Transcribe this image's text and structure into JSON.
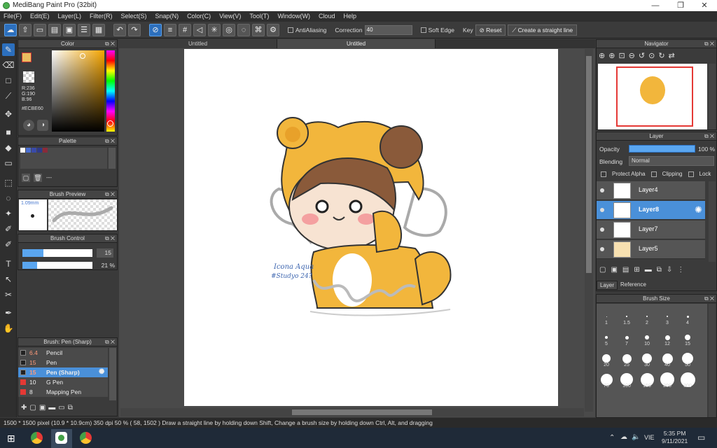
{
  "window": {
    "title": "MediBang Paint Pro (32bit)",
    "min": "—",
    "max": "❐",
    "close": "✕"
  },
  "menu": [
    "File(F)",
    "Edit(E)",
    "Layer(L)",
    "Filter(R)",
    "Select(S)",
    "Snap(N)",
    "Color(C)",
    "View(V)",
    "Tool(T)",
    "Window(W)",
    "Cloud",
    "Help"
  ],
  "toolbar": {
    "antialiasing": "AntiAliasing",
    "correction_label": "Correction",
    "correction_value": "40",
    "soft_edge": "Soft Edge",
    "key_label": "Key",
    "reset": "Reset",
    "straight_line": "Create a straight line"
  },
  "tabs": [
    "Untitled",
    "Untitled"
  ],
  "color_panel": {
    "title": "Color",
    "r": "R:236",
    "g": "G:190",
    "b": "B:96",
    "hex": "#ECBE60",
    "fg": "#ecbe60"
  },
  "palette_panel": {
    "title": "Palette",
    "placeholder": "---"
  },
  "brush_preview": {
    "title": "Brush Preview",
    "size": "1.09mm"
  },
  "brush_control": {
    "title": "Brush Control",
    "size_value": "15",
    "opacity_value": "21 %"
  },
  "brush_list": {
    "title": "Brush: Pen (Sharp)",
    "items": [
      {
        "size": "6.4",
        "name": "Pencil",
        "color": "#222"
      },
      {
        "size": "15",
        "name": "Pen",
        "color": "#222"
      },
      {
        "size": "15",
        "name": "Pen (Sharp)",
        "color": "#222"
      },
      {
        "size": "10",
        "name": "G Pen",
        "color": "#e53935"
      },
      {
        "size": "8",
        "name": "Mapping Pen",
        "color": "#e53935"
      }
    ]
  },
  "navigator": {
    "title": "Navigator"
  },
  "layer_panel": {
    "title": "Layer",
    "opacity_label": "Opacity",
    "opacity_value": "100 %",
    "opacity_level": 1.0,
    "blending_label": "Blending",
    "blending_value": "Normal",
    "protect_alpha": "Protect Alpha",
    "clipping": "Clipping",
    "lock": "Lock",
    "layers": [
      "Layer4",
      "Layer8",
      "Layer7",
      "Layer5"
    ],
    "tabs": [
      "Layer",
      "Reference"
    ]
  },
  "brush_size": {
    "title": "Brush Size",
    "sizes": [
      "1",
      "1.5",
      "2",
      "3",
      "4",
      "5",
      "7",
      "10",
      "12",
      "15",
      "20",
      "25",
      "30",
      "40",
      "50",
      "70",
      "100",
      "150",
      "200",
      "300"
    ]
  },
  "canvas": {
    "signature_line1": "Icona Aqua",
    "signature_line2": "#Studyo 24?"
  },
  "status": "1500 * 1500 pixel   (10.9 * 10.9cm)  350 dpi   50 %   ( 58, 1502 )   Draw a straight line by holding down Shift, Change a brush size by holding down Ctrl, Alt, and dragging",
  "taskbar": {
    "lang": "VIE",
    "time": "5:35 PM",
    "date": "9/11/2021"
  }
}
